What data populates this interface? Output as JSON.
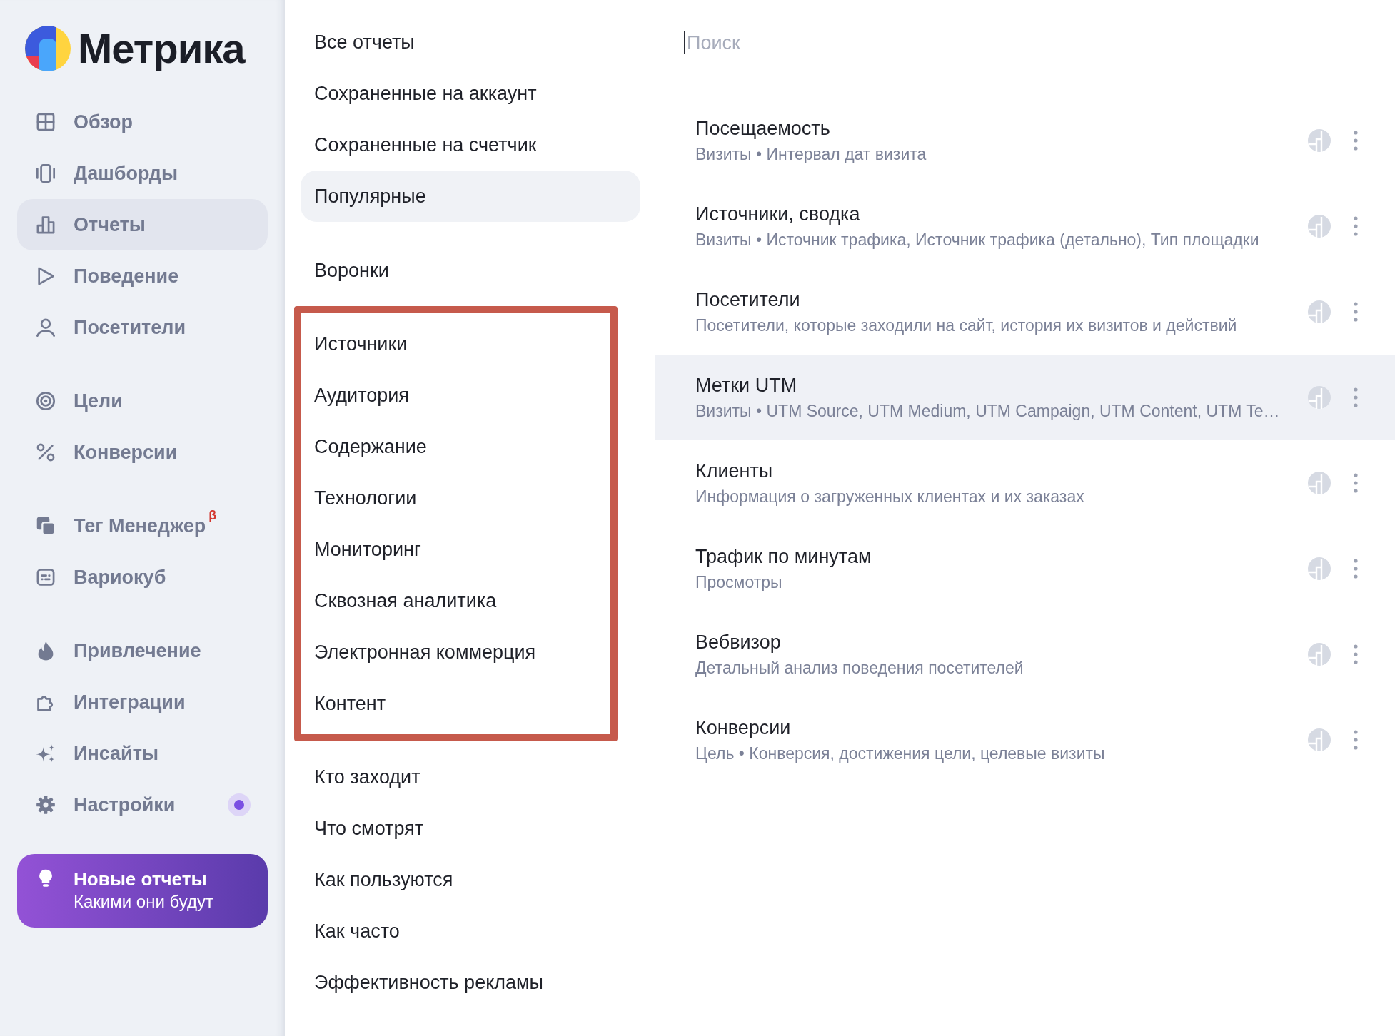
{
  "sidebar": {
    "logo": {
      "text": "Метрика"
    },
    "groups": [
      {
        "items": [
          {
            "label": "Обзор",
            "selected": false,
            "notification": false
          },
          {
            "label": "Дашборды",
            "selected": false,
            "notification": false
          },
          {
            "label": "Отчеты",
            "selected": true,
            "notification": false
          },
          {
            "label": "Поведение",
            "selected": false,
            "notification": false
          },
          {
            "label": "Посетители",
            "selected": false,
            "notification": false
          }
        ]
      },
      {
        "items": [
          {
            "label": "Цели",
            "selected": false,
            "notification": false
          },
          {
            "label": "Конверсии",
            "selected": false,
            "notification": false
          }
        ]
      },
      {
        "items": [
          {
            "label": "Тег Менеджер",
            "badge": "β",
            "selected": false,
            "notification": false
          },
          {
            "label": "Вариокуб",
            "selected": false,
            "notification": false
          }
        ]
      },
      {
        "items": [
          {
            "label": "Привлечение",
            "selected": false,
            "notification": false
          },
          {
            "label": "Интеграции",
            "selected": false,
            "notification": false
          },
          {
            "label": "Инсайты",
            "selected": false,
            "notification": false
          },
          {
            "label": "Настройки",
            "selected": false,
            "notification": true
          }
        ]
      }
    ],
    "promo": {
      "title": "Новые отчеты",
      "subtitle": "Какими они будут"
    }
  },
  "report_menu": {
    "sections": [
      {
        "highlighted": false,
        "items": [
          {
            "label": "Все отчеты",
            "selected": false
          },
          {
            "label": "Сохраненные на аккаунт",
            "selected": false
          },
          {
            "label": "Сохраненные на счетчик",
            "selected": false
          },
          {
            "label": "Популярные",
            "selected": true
          }
        ]
      },
      {
        "highlighted": false,
        "items": [
          {
            "label": "Воронки",
            "selected": false
          }
        ]
      },
      {
        "highlighted": true,
        "items": [
          {
            "label": "Источники",
            "selected": false
          },
          {
            "label": "Аудитория",
            "selected": false
          },
          {
            "label": "Содержание",
            "selected": false
          },
          {
            "label": "Технологии",
            "selected": false
          },
          {
            "label": "Мониторинг",
            "selected": false
          },
          {
            "label": "Сквозная аналитика",
            "selected": false
          },
          {
            "label": "Электронная коммерция",
            "selected": false
          },
          {
            "label": "Контент",
            "selected": false
          }
        ]
      },
      {
        "highlighted": false,
        "items": [
          {
            "label": "Кто заходит",
            "selected": false
          },
          {
            "label": "Что смотрят",
            "selected": false
          },
          {
            "label": "Как пользуются",
            "selected": false
          },
          {
            "label": "Как часто",
            "selected": false
          },
          {
            "label": "Эффективность рекламы",
            "selected": false
          }
        ]
      }
    ]
  },
  "reports": {
    "search": {
      "placeholder": "Поиск"
    },
    "rows": [
      {
        "title": "Посещаемость",
        "subtitle": "Визиты • Интервал дат визита",
        "hovered": false
      },
      {
        "title": "Источники, сводка",
        "subtitle": "Визиты • Источник трафика, Источник трафика (детально), Тип площадки",
        "hovered": false
      },
      {
        "title": "Посетители",
        "subtitle": "Посетители, которые заходили на сайт, история их визитов и действий",
        "hovered": false
      },
      {
        "title": "Метки UTM",
        "subtitle": "Визиты • UTM Source, UTM Medium, UTM Campaign, UTM Content, UTM Te…",
        "hovered": true
      },
      {
        "title": "Клиенты",
        "subtitle": "Информация о загруженных клиентах и их заказах",
        "hovered": false
      },
      {
        "title": "Трафик по минутам",
        "subtitle": "Просмотры",
        "hovered": false
      },
      {
        "title": "Вебвизор",
        "subtitle": "Детальный анализ поведения посетителей",
        "hovered": false
      },
      {
        "title": "Конверсии",
        "subtitle": "Цель • Конверсия, достижения цели, целевые визиты",
        "hovered": false
      }
    ]
  }
}
